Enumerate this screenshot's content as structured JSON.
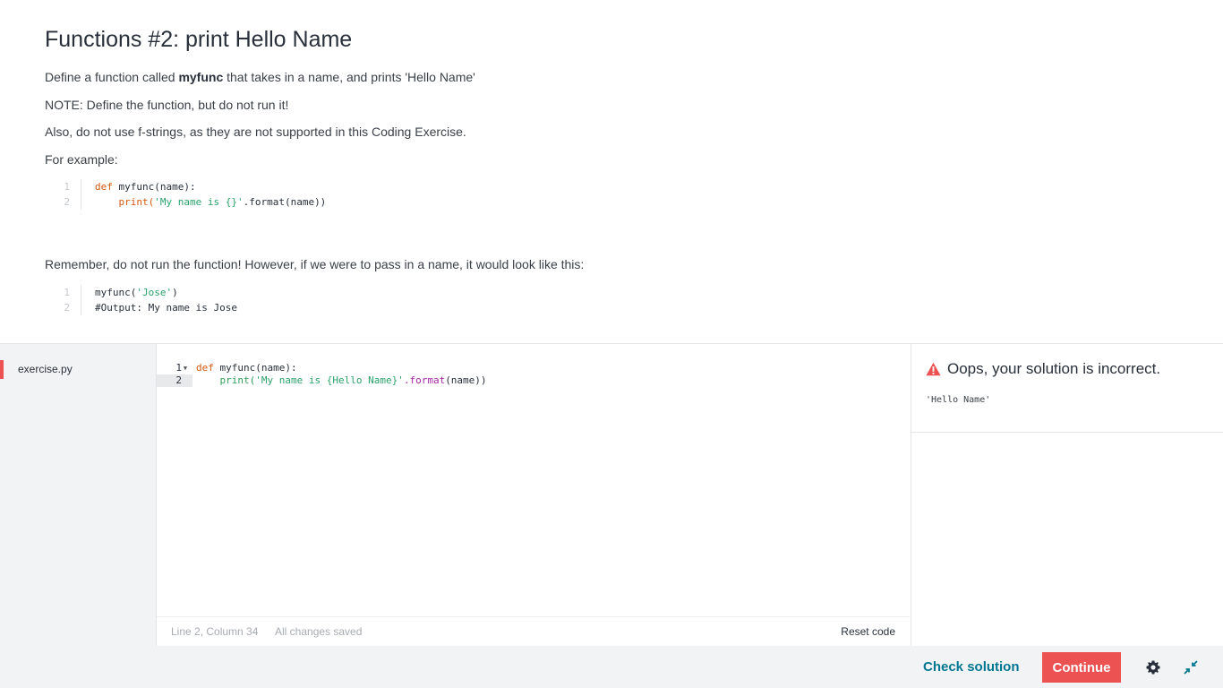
{
  "instructions": {
    "title": "Functions #2: print Hello Name",
    "intro_prefix": "Define a function called ",
    "intro_bold": "myfunc",
    "intro_suffix": " that takes in a name, and prints 'Hello Name'",
    "note": "NOTE: Define the function, but do not run it!",
    "also": "Also, do not use f-strings, as they are not supported in this Coding Exercise.",
    "for_example": "For example:",
    "example1": {
      "line_numbers": [
        "1",
        "2"
      ],
      "line1_kw": "def",
      "line1_rest": " myfunc(name):",
      "line2_indent": "    ",
      "line2_fn": "print(",
      "line2_str": "'My name is {}'",
      "line2_rest": ".format(name))"
    },
    "remember": "Remember, do not run the function! However, if we were to pass in a name, it would look like this:",
    "example2": {
      "line_numbers": [
        "1",
        "2"
      ],
      "line1_fn": "myfunc(",
      "line1_str": "'Jose'",
      "line1_rest": ")",
      "line2_comment": "#Output: My name is Jose"
    }
  },
  "files": {
    "items": [
      {
        "label": "exercise.py"
      }
    ]
  },
  "editor": {
    "gutter": [
      "1",
      "2"
    ],
    "line1_kw": "def",
    "line1_rest": " myfunc(name):",
    "line2_indent": "    ",
    "line2_fn": "print(",
    "line2_str": "'My name is {Hello Name}'",
    "line2_meth": ".format",
    "line2_rest": "(name))",
    "status_position": "Line 2, Column 34",
    "status_saved": "All changes saved",
    "reset_label": "Reset code"
  },
  "result": {
    "heading": "Oops, your solution is incorrect.",
    "output": "'Hello Name'",
    "icon": "warning-icon",
    "icon_color": "#ec5252"
  },
  "footer": {
    "check_label": "Check solution",
    "continue_label": "Continue",
    "settings_icon": "gear-icon",
    "collapse_icon": "collapse-icon",
    "accent_color": "#007791",
    "primary_color": "#ec5252"
  }
}
